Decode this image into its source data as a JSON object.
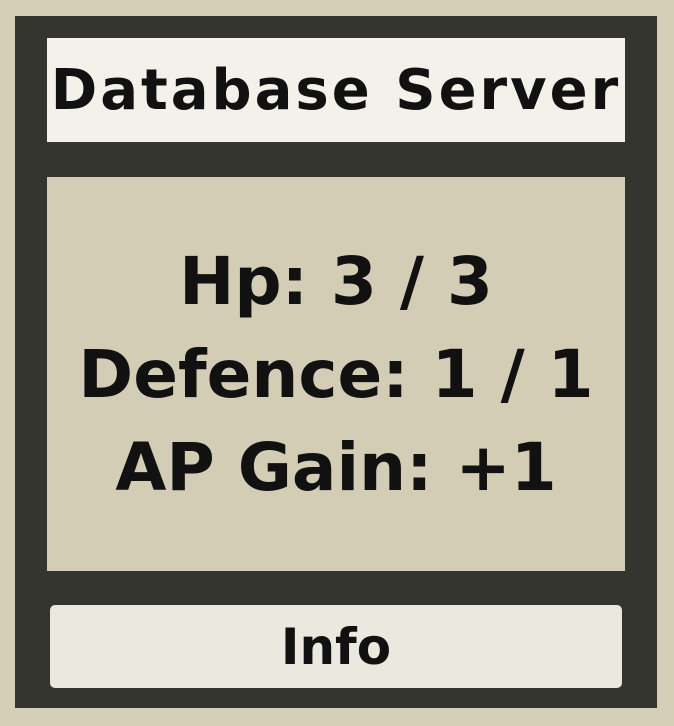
{
  "card": {
    "title": "Database Server",
    "stats": {
      "hp": "Hp: 3 / 3",
      "defence": "Defence: 1 / 1",
      "ap_gain": "AP Gain: +1"
    },
    "info_label": "Info"
  },
  "colors": {
    "background": "#d6cfb8",
    "frame": "#353530",
    "title_panel": "#f3f1ea",
    "stats_panel": "#d4cdb6",
    "button": "#ebe8e0",
    "text": "#111111"
  }
}
